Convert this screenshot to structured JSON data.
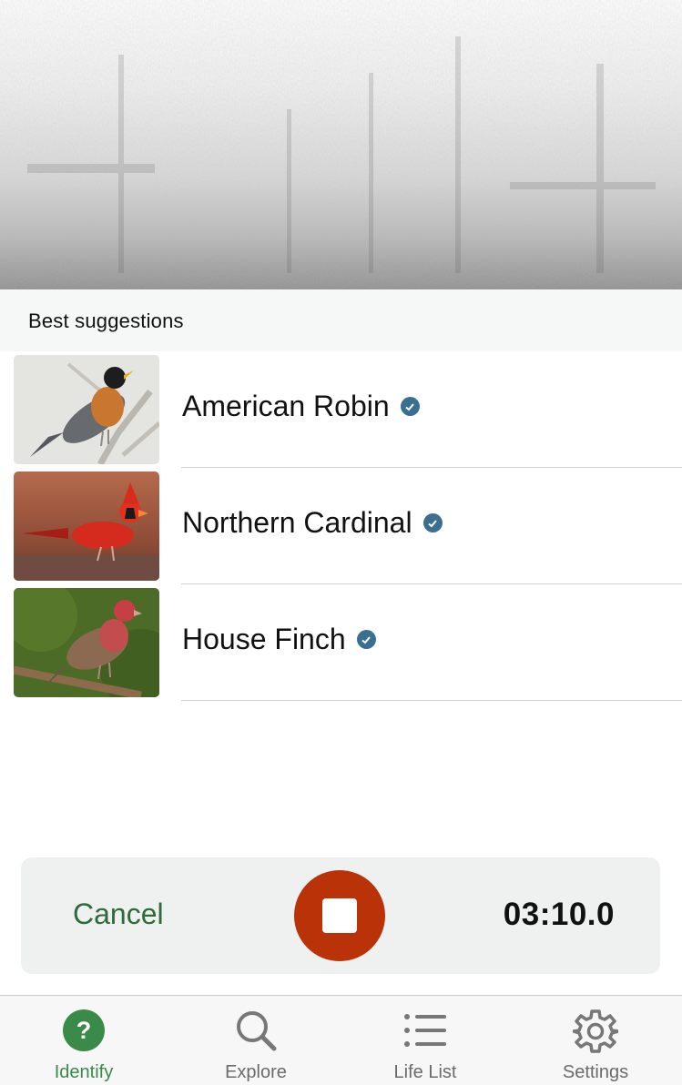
{
  "section": {
    "title": "Best suggestions"
  },
  "suggestions": [
    {
      "name": "American Robin",
      "verified": true,
      "thumbnail": "american-robin-photo"
    },
    {
      "name": "Northern Cardinal",
      "verified": true,
      "thumbnail": "northern-cardinal-photo"
    },
    {
      "name": "House Finch",
      "verified": true,
      "thumbnail": "house-finch-photo"
    }
  ],
  "recorder": {
    "cancel_label": "Cancel",
    "stop_icon": "stop-icon",
    "timer": "03:10.0"
  },
  "tabs": [
    {
      "label": "Identify",
      "icon": "question-mark-icon",
      "active": true
    },
    {
      "label": "Explore",
      "icon": "search-icon",
      "active": false
    },
    {
      "label": "Life List",
      "icon": "list-icon",
      "active": false
    },
    {
      "label": "Settings",
      "icon": "gear-icon",
      "active": false
    }
  ],
  "colors": {
    "accent_green": "#3a8a4a",
    "cancel_green": "#2f6b3a",
    "stop_red": "#b93208",
    "verified_blue": "#3c6e8f"
  }
}
